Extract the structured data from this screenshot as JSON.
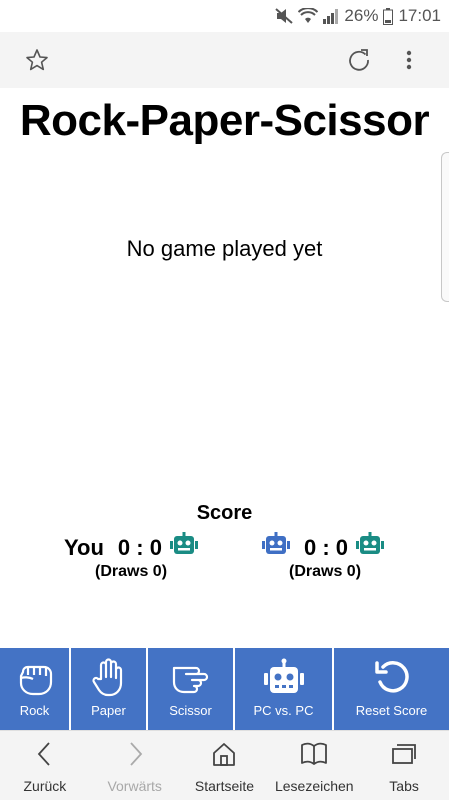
{
  "status": {
    "battery": "26%",
    "time": "17:01"
  },
  "toolbar": {
    "star_icon": "star-icon",
    "reload_icon": "reload-icon",
    "menu_icon": "more-vertical-icon"
  },
  "page": {
    "title": "Rock-Paper-Scissor",
    "result_text": "No game played yet"
  },
  "score": {
    "title": "Score",
    "left": {
      "label": "You",
      "value": "0 : 0",
      "draws": "(Draws 0)"
    },
    "right": {
      "value": "0 : 0",
      "draws": "(Draws 0)"
    },
    "colors": {
      "bot_teal": "#1a8c84",
      "bot_blue": "#3f6fc4"
    }
  },
  "actions": [
    {
      "label": "Rock",
      "icon": "fist-icon"
    },
    {
      "label": "Paper",
      "icon": "hand-icon"
    },
    {
      "label": "Scissor",
      "icon": "scissor-hand-icon"
    },
    {
      "label": "PC vs. PC",
      "icon": "robot-icon"
    },
    {
      "label": "Reset Score",
      "icon": "reset-icon"
    }
  ],
  "action_color": "#4473c5",
  "nav": [
    {
      "label": "Zurück",
      "icon": "back-icon"
    },
    {
      "label": "Vorwärts",
      "icon": "forward-icon"
    },
    {
      "label": "Startseite",
      "icon": "home-icon"
    },
    {
      "label": "Lesezeichen",
      "icon": "bookmark-book-icon"
    },
    {
      "label": "Tabs",
      "icon": "tabs-icon"
    }
  ]
}
